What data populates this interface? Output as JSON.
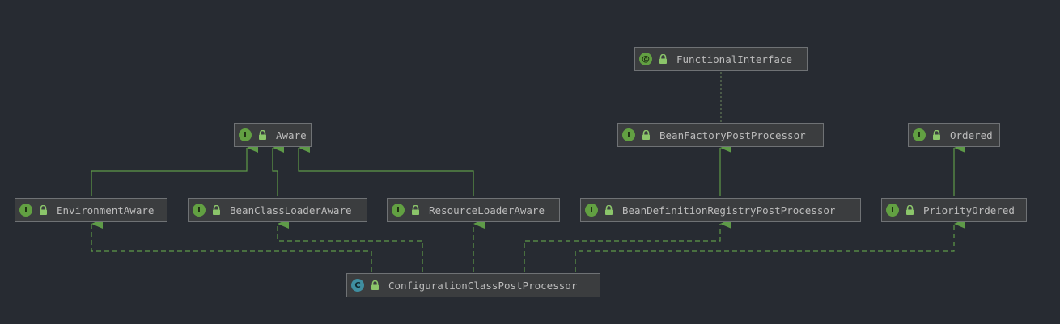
{
  "colors": {
    "background": "#272b32",
    "node_fill": "#3b3d3f",
    "node_border": "#6f7275",
    "edge": "#5e9a48",
    "interface_badge": "#62a042",
    "class_badge": "#3f8ea0",
    "text": "#bcbcbc"
  },
  "nodes": [
    {
      "id": "functionalinterface",
      "badge": "@",
      "kind": "annotation",
      "icon": "lock-icon",
      "label": "FunctionalInterface"
    },
    {
      "id": "aware",
      "badge": "I",
      "kind": "interface",
      "icon": "lock-icon",
      "label": "Aware"
    },
    {
      "id": "beanfactorypostprocessor",
      "badge": "I",
      "kind": "interface",
      "icon": "lock-icon",
      "label": "BeanFactoryPostProcessor"
    },
    {
      "id": "ordered",
      "badge": "I",
      "kind": "interface",
      "icon": "lock-icon",
      "label": "Ordered"
    },
    {
      "id": "environmentaware",
      "badge": "I",
      "kind": "interface",
      "icon": "lock-icon",
      "label": "EnvironmentAware"
    },
    {
      "id": "beanclassloaderaware",
      "badge": "I",
      "kind": "interface",
      "icon": "lock-icon",
      "label": "BeanClassLoaderAware"
    },
    {
      "id": "resourceloaderaware",
      "badge": "I",
      "kind": "interface",
      "icon": "lock-icon",
      "label": "ResourceLoaderAware"
    },
    {
      "id": "beandefinitionregistrypostprocessor",
      "badge": "I",
      "kind": "interface",
      "icon": "lock-icon",
      "label": "BeanDefinitionRegistryPostProcessor"
    },
    {
      "id": "priorityordered",
      "badge": "I",
      "kind": "interface",
      "icon": "lock-icon",
      "label": "PriorityOrdered"
    },
    {
      "id": "configurationclasspostprocessor",
      "badge": "C",
      "kind": "class",
      "icon": "lock-icon",
      "label": "ConfigurationClassPostProcessor"
    }
  ],
  "edges": [
    {
      "from": "environmentaware",
      "to": "aware",
      "type": "extends"
    },
    {
      "from": "beanclassloaderaware",
      "to": "aware",
      "type": "extends"
    },
    {
      "from": "resourceloaderaware",
      "to": "aware",
      "type": "extends"
    },
    {
      "from": "beandefinitionregistrypostprocessor",
      "to": "beanfactorypostprocessor",
      "type": "extends"
    },
    {
      "from": "priorityordered",
      "to": "ordered",
      "type": "extends"
    },
    {
      "from": "beanfactorypostprocessor",
      "to": "functionalinterface",
      "type": "annotated"
    },
    {
      "from": "configurationclasspostprocessor",
      "to": "environmentaware",
      "type": "implements"
    },
    {
      "from": "configurationclasspostprocessor",
      "to": "beanclassloaderaware",
      "type": "implements"
    },
    {
      "from": "configurationclasspostprocessor",
      "to": "resourceloaderaware",
      "type": "implements"
    },
    {
      "from": "configurationclasspostprocessor",
      "to": "beandefinitionregistrypostprocessor",
      "type": "implements"
    },
    {
      "from": "configurationclasspostprocessor",
      "to": "priorityordered",
      "type": "implements"
    }
  ]
}
